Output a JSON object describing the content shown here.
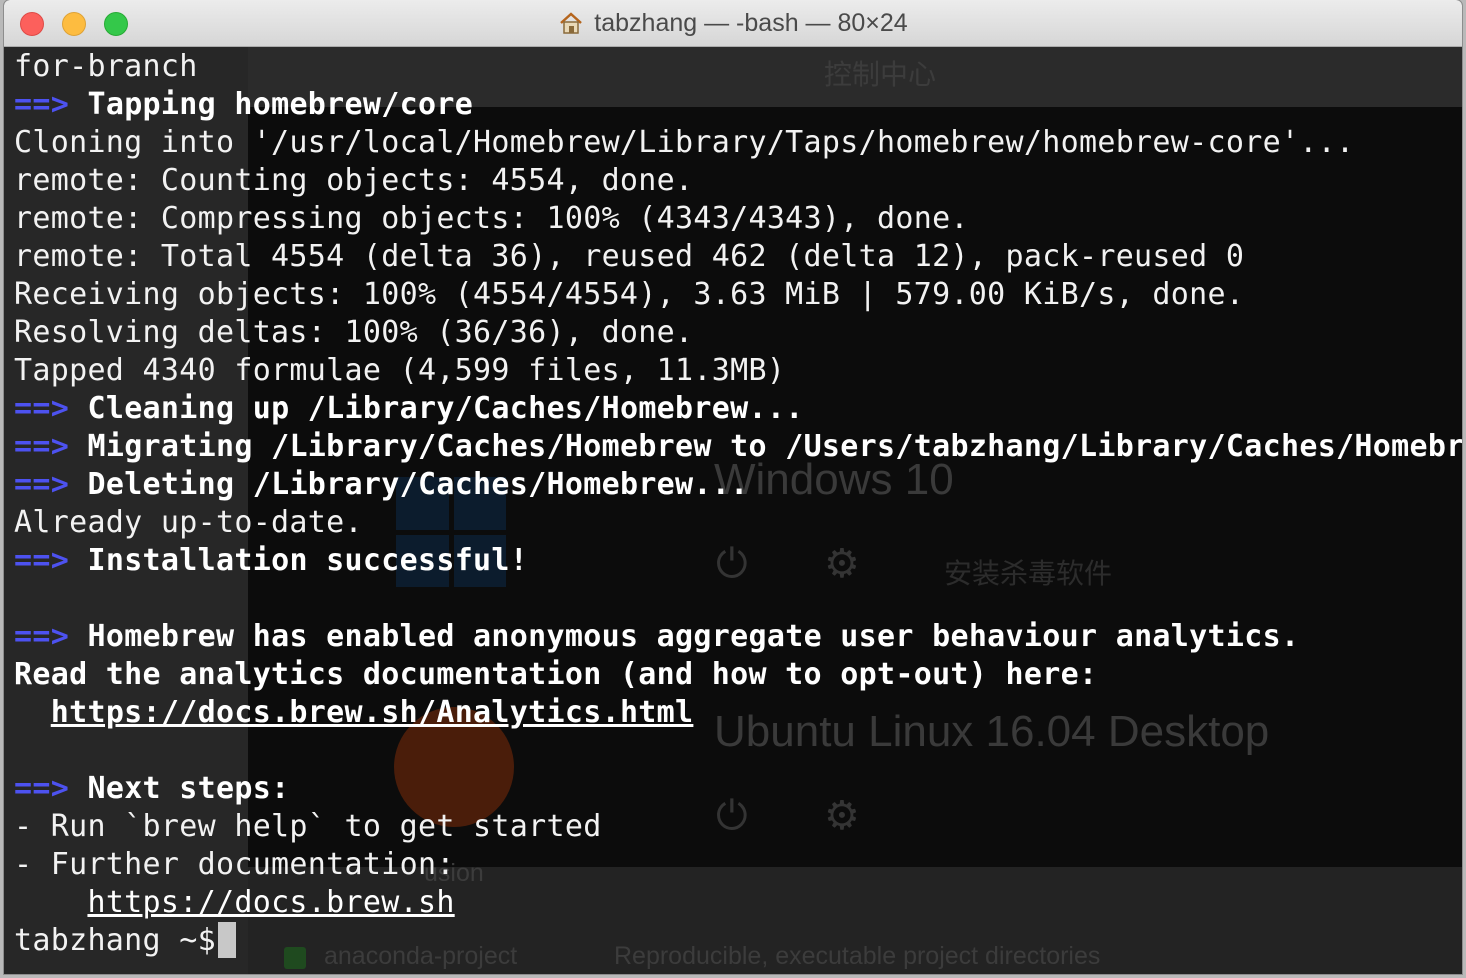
{
  "window": {
    "title": "tabzhang — -bash — 80×24",
    "icons": [
      "close-button",
      "minimize-button",
      "zoom-button",
      "house-icon"
    ]
  },
  "background_app": {
    "control_center": "控制中心",
    "windows10": "Windows 10",
    "antivirus": "安装杀毒软件",
    "ubuntu": "Ubuntu Linux 16.04 Desktop",
    "fusion": "usion",
    "anaconda": "anaconda-project",
    "reproducible": "Reproducible, executable project directories"
  },
  "terminal": {
    "arrow": "==>",
    "l01": "for-branch",
    "l02": "Tapping homebrew/core",
    "l03": "Cloning into '/usr/local/Homebrew/Library/Taps/homebrew/homebrew-core'...",
    "l04": "remote: Counting objects: 4554, done.",
    "l05": "remote: Compressing objects: 100% (4343/4343), done.",
    "l06": "remote: Total 4554 (delta 36), reused 462 (delta 12), pack-reused 0",
    "l07": "Receiving objects: 100% (4554/4554), 3.63 MiB | 579.00 KiB/s, done.",
    "l08": "Resolving deltas: 100% (36/36), done.",
    "l09": "Tapped 4340 formulae (4,599 files, 11.3MB)",
    "l10": "Cleaning up /Library/Caches/Homebrew...",
    "l11": "Migrating /Library/Caches/Homebrew to /Users/tabzhang/Library/Caches/Homebre",
    "l12": "Deleting /Library/Caches/Homebrew...",
    "l13": "Already up-to-date.",
    "l14": "Installation successful!",
    "l16": "Homebrew has enabled anonymous aggregate user behaviour analytics.",
    "l17": "Read the analytics documentation (and how to opt-out) here:",
    "l18": "https://docs.brew.sh/Analytics.html",
    "l20": "Next steps:",
    "l21": "- Run `brew help` to get started",
    "l22": "- Further documentation:",
    "l23": "https://docs.brew.sh",
    "prompt": "tabzhang ~$"
  }
}
